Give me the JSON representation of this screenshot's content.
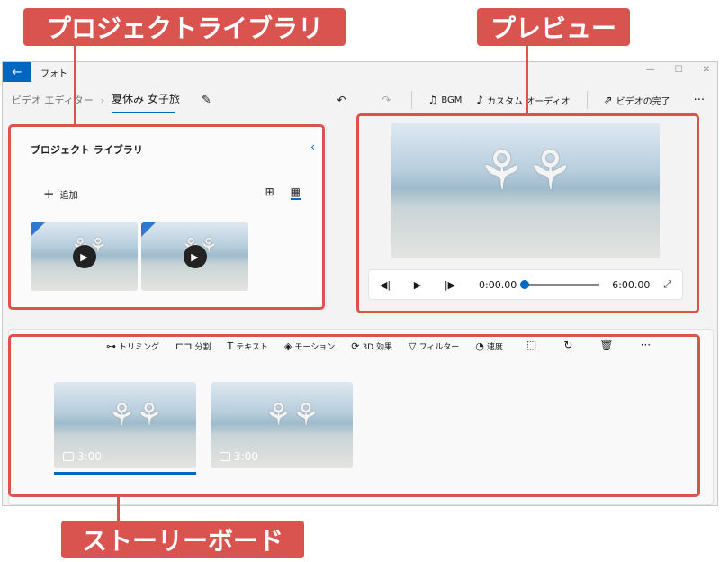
{
  "callouts": {
    "library": "プロジェクトライブラリ",
    "preview": "プレビュー",
    "storyboard": "ストーリーボード"
  },
  "window": {
    "back_icon": "back-arrow-icon",
    "title": "フォト",
    "controls": [
      "—",
      "☐",
      "✕"
    ]
  },
  "toolbar": {
    "breadcrumb_root": "ビデオ エディター",
    "breadcrumb_sep": "›",
    "project_name": "夏休み 女子旅",
    "undo": "↶",
    "redo": "↷",
    "bgm_label": "BGM",
    "custom_audio_label": "カスタム オーディオ",
    "finish_label": "ビデオの完了",
    "more": "···"
  },
  "library": {
    "title": "プロジェクト ライブラリ",
    "collapse": "‹",
    "add_label": "追加",
    "add_icon": "+"
  },
  "preview": {
    "current_time": "0:00.00",
    "total_time": "6:00.00",
    "progress": 0.0
  },
  "storyboard": {
    "tools": [
      {
        "icon": "⊶",
        "label": "トリミング"
      },
      {
        "icon": "⊏⊐",
        "label": "分割"
      },
      {
        "icon": "T",
        "label": "テキスト"
      },
      {
        "icon": "◈",
        "label": "モーション"
      },
      {
        "icon": "⟳",
        "label": "3D 効果"
      },
      {
        "icon": "▽",
        "label": "フィルター"
      },
      {
        "icon": "◔",
        "label": "速度"
      }
    ],
    "clips": [
      {
        "duration": "3:00",
        "selected": true
      },
      {
        "duration": "3:00",
        "selected": false
      }
    ]
  },
  "colors": {
    "accent": "#0067c0",
    "callout": "#d9534f"
  }
}
